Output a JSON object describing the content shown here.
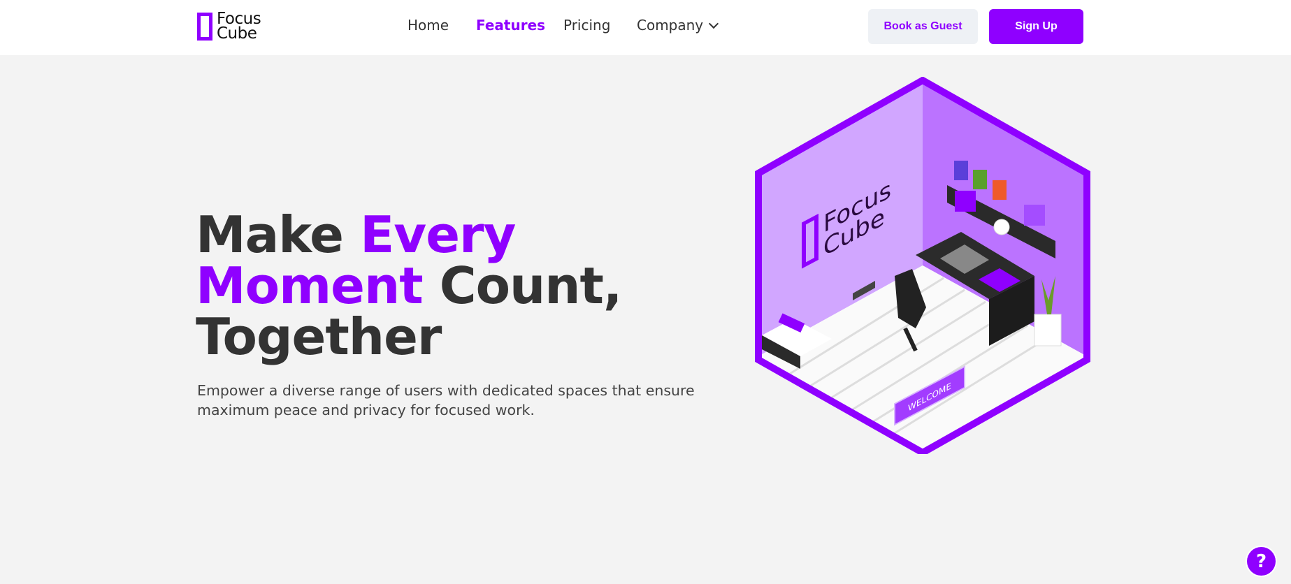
{
  "brand": {
    "line1": "Focus",
    "line2": "Cube",
    "color": "#8f00ff"
  },
  "nav": {
    "home": "Home",
    "features": "Features",
    "pricing": "Pricing",
    "company": "Company"
  },
  "actions": {
    "guest": "Book as Guest",
    "signup": "Sign Up"
  },
  "hero": {
    "title_part1": "Make ",
    "title_part2": "Every Moment",
    "title_part3": " Count, Together",
    "subtitle": "Empower a diverse range of users with dedicated spaces that ensure maximum peace and privacy for focused work."
  },
  "illustration": {
    "wall_logo_line1": "Focus",
    "wall_logo_line2": "Cube",
    "mat_text": "WELCOME"
  },
  "help": {
    "label": "?"
  }
}
